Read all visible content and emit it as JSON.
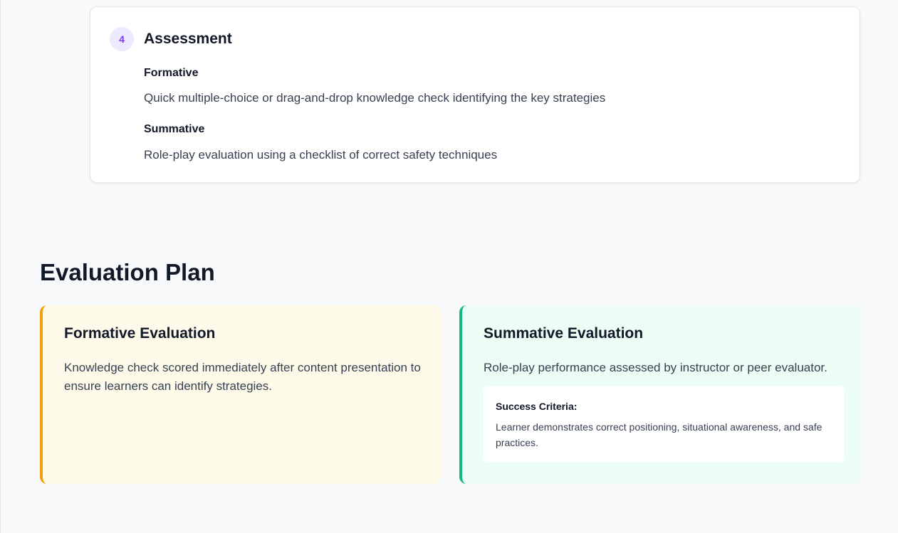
{
  "step": {
    "number": "4",
    "title": "Assessment",
    "items": [
      {
        "heading": "Formative",
        "text": "Quick multiple-choice or drag-and-drop knowledge check identifying the key strategies"
      },
      {
        "heading": "Summative",
        "text": "Role-play evaluation using a checklist of correct safety techniques"
      }
    ]
  },
  "evaluation": {
    "title": "Evaluation Plan",
    "formative": {
      "title": "Formative Evaluation",
      "text": "Knowledge check scored immediately after content presentation to ensure learners can identify strategies."
    },
    "summative": {
      "title": "Summative Evaluation",
      "text": "Role-play performance assessed by instructor or peer evaluator.",
      "criteria_label": "Success Criteria:",
      "criteria_text": "Learner demonstrates correct positioning, situational awareness, and safe practices."
    }
  },
  "colors": {
    "accent_purple": "#7c3aed",
    "formative_border": "#f59e0b",
    "summative_border": "#10b981"
  }
}
